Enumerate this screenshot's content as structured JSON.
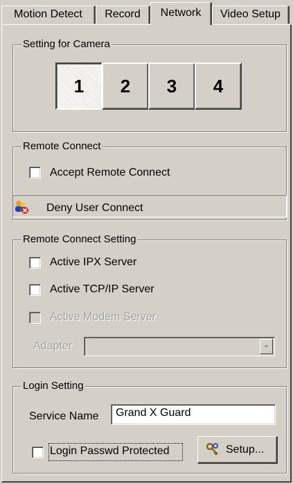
{
  "tabs": [
    {
      "label": "Motion Detect",
      "active": false
    },
    {
      "label": "Record",
      "active": false
    },
    {
      "label": "Network",
      "active": true
    },
    {
      "label": "Video Setup",
      "active": false
    }
  ],
  "camera_group": {
    "title": "Setting for Camera",
    "buttons": [
      "1",
      "2",
      "3",
      "4"
    ],
    "selected": "1"
  },
  "remote_connect": {
    "title": "Remote Connect",
    "accept_label": "Accept Remote Connect",
    "accept_checked": false,
    "deny_label": "Deny User Connect",
    "deny_icon": "users-denied-icon"
  },
  "remote_connect_setting": {
    "title": "Remote Connect Setting",
    "ipx_label": "Active IPX Server",
    "tcpip_label": "Active TCP/IP Server",
    "modem_label": "Active Modem Server",
    "adapter_label": "Adapter",
    "adapter_value": ""
  },
  "login_setting": {
    "title": "Login Setting",
    "service_name_label": "Service Name",
    "service_name_value": "Grand X Guard",
    "passwd_label": "Login Passwd Protected",
    "setup_label": "Setup..."
  },
  "colors": {
    "face": "#d4d0c8",
    "shadow": "#808080",
    "highlight": "#ffffff",
    "disabled_text": "#a0a0a0"
  }
}
